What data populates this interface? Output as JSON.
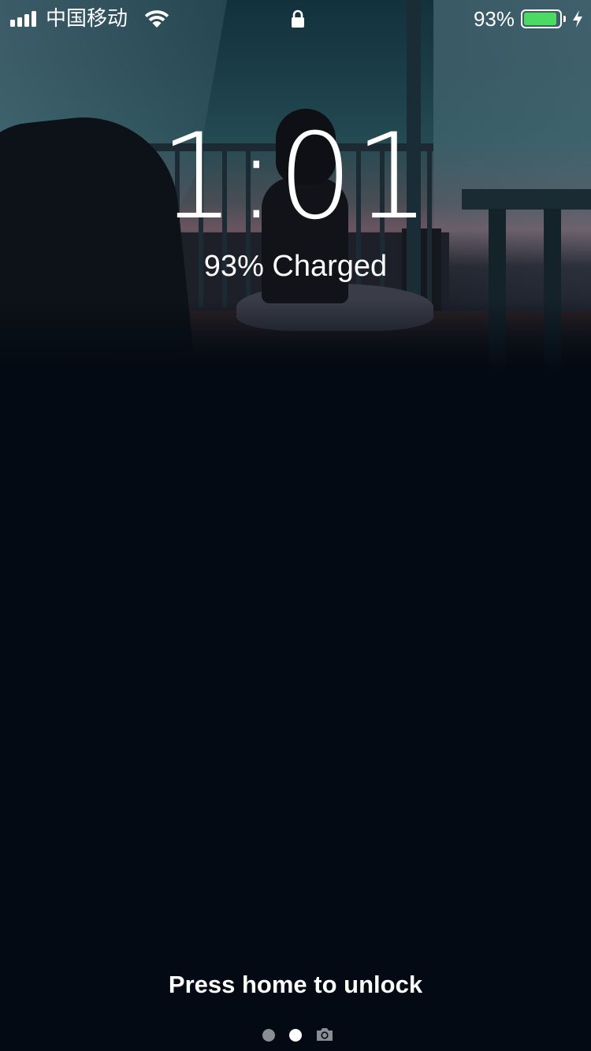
{
  "status_bar": {
    "carrier": "中国移动",
    "battery_percent": "93%",
    "battery_level": 0.93,
    "charging": true,
    "battery_color": "#4cd964",
    "icons": [
      "signal-icon",
      "wifi-icon",
      "lock-icon",
      "battery-icon",
      "charging-bolt-icon"
    ]
  },
  "lock_screen": {
    "time": "1:01",
    "charge_status": "93% Charged",
    "unlock_hint": "Press home to unlock"
  },
  "page_indicator": {
    "pages": 2,
    "active_index": 1,
    "camera_icon": "camera-icon"
  }
}
